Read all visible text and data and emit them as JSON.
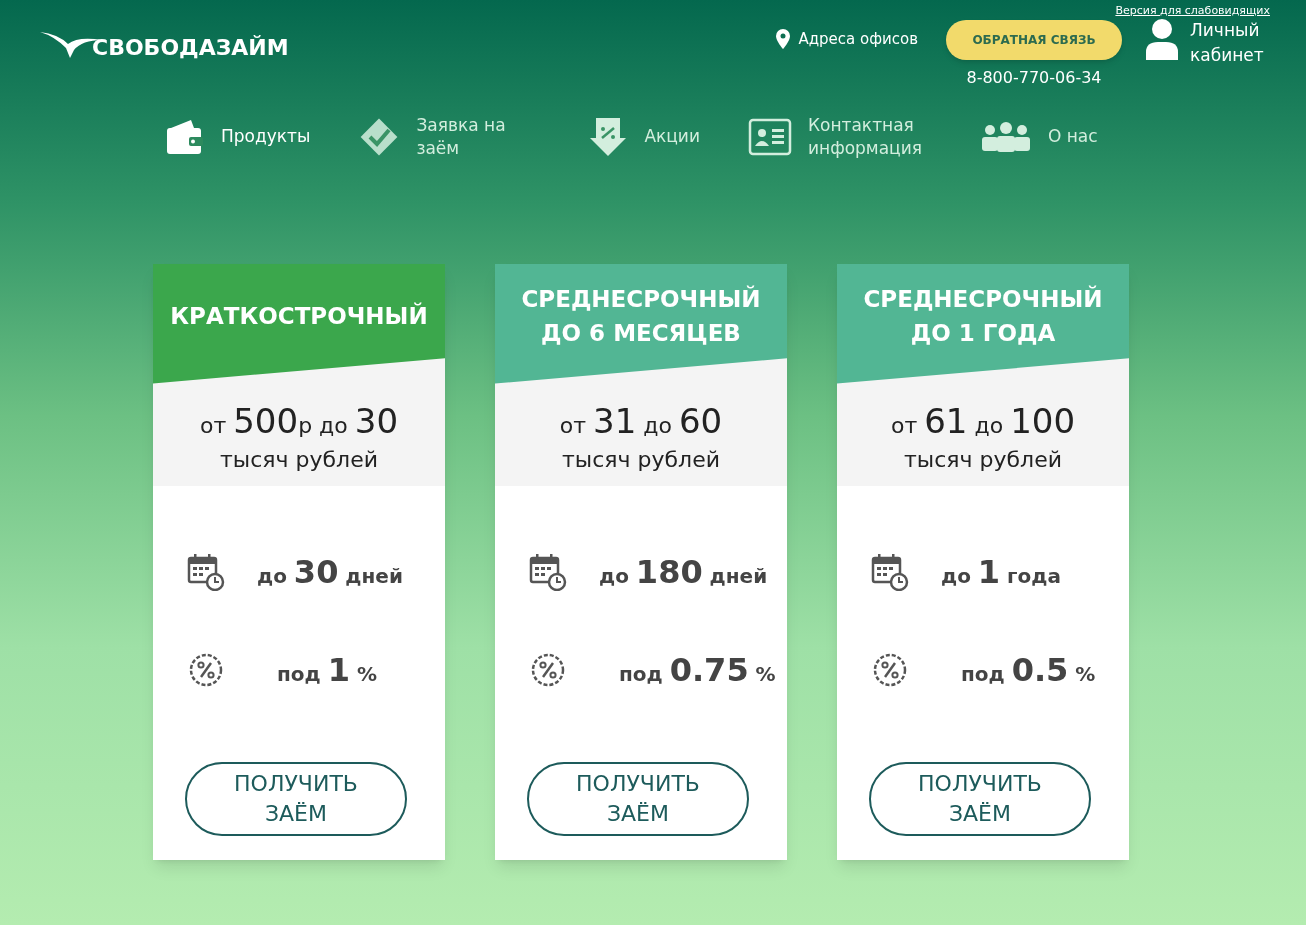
{
  "header": {
    "accessibility_link": "Версия для слабовидящих",
    "logo": "СВОБОДАЗАЙМ",
    "office_link": "Адреса офисов",
    "callback_button": "ОБРАТНАЯ СВЯЗЬ",
    "phone": "8-800-770-06-34",
    "account_link": "Личный кабинет"
  },
  "nav": [
    {
      "label": "Продукты",
      "kind": "wallet",
      "selected": true
    },
    {
      "label": "Заявка на заём",
      "kind": "check",
      "selected": false
    },
    {
      "label": "Акции",
      "kind": "discount",
      "selected": false
    },
    {
      "label": "Контактная информация",
      "kind": "card",
      "selected": false
    },
    {
      "label": "О нас",
      "kind": "people",
      "selected": false
    }
  ],
  "cards": [
    {
      "title": "КРАТКОСТРОЧНЫЙ",
      "color": "#3ba74c",
      "amount": [
        {
          "text": "от ",
          "kind": "small"
        },
        {
          "text": "500",
          "kind": "large"
        },
        {
          "text": "р до ",
          "kind": "small"
        },
        {
          "text": "30",
          "kind": "large"
        }
      ],
      "amount_unit": "тысяч рублей",
      "term": [
        {
          "text": "до ",
          "kind": "small"
        },
        {
          "text": "30",
          "kind": "large"
        },
        {
          "text": " дней",
          "kind": "small"
        }
      ],
      "rate": [
        {
          "text": "под ",
          "kind": "small"
        },
        {
          "text": "1",
          "kind": "large"
        },
        {
          "text": " %",
          "kind": "small"
        }
      ],
      "button": "ПОЛУЧИТЬ ЗАЁМ"
    },
    {
      "title": "СРЕДНЕСРОЧНЫЙ ДО 6 МЕСЯЦЕВ",
      "color": "#52b694",
      "amount": [
        {
          "text": "от ",
          "kind": "small"
        },
        {
          "text": "31",
          "kind": "large"
        },
        {
          "text": " до ",
          "kind": "small"
        },
        {
          "text": "60",
          "kind": "large"
        }
      ],
      "amount_unit": "тысяч рублей",
      "term": [
        {
          "text": "до ",
          "kind": "small"
        },
        {
          "text": "180",
          "kind": "large"
        },
        {
          "text": " дней",
          "kind": "small"
        }
      ],
      "rate": [
        {
          "text": "под ",
          "kind": "small"
        },
        {
          "text": "0.75",
          "kind": "large"
        },
        {
          "text": " %",
          "kind": "small"
        }
      ],
      "button": "ПОЛУЧИТЬ ЗАЁМ"
    },
    {
      "title": "СРЕДНЕСРОЧНЫЙ ДО 1 ГОДА",
      "color": "#52b694",
      "amount": [
        {
          "text": "от ",
          "kind": "small"
        },
        {
          "text": "61",
          "kind": "large"
        },
        {
          "text": " до ",
          "kind": "small"
        },
        {
          "text": "100",
          "kind": "large"
        }
      ],
      "amount_unit": "тысяч рублей",
      "term": [
        {
          "text": "до ",
          "kind": "small"
        },
        {
          "text": "1",
          "kind": "large"
        },
        {
          "text": " года",
          "kind": "small"
        }
      ],
      "rate": [
        {
          "text": "под ",
          "kind": "small"
        },
        {
          "text": "0.5",
          "kind": "large"
        },
        {
          "text": " %",
          "kind": "small"
        }
      ],
      "button": "ПОЛУЧИТЬ ЗАЁМ"
    }
  ]
}
